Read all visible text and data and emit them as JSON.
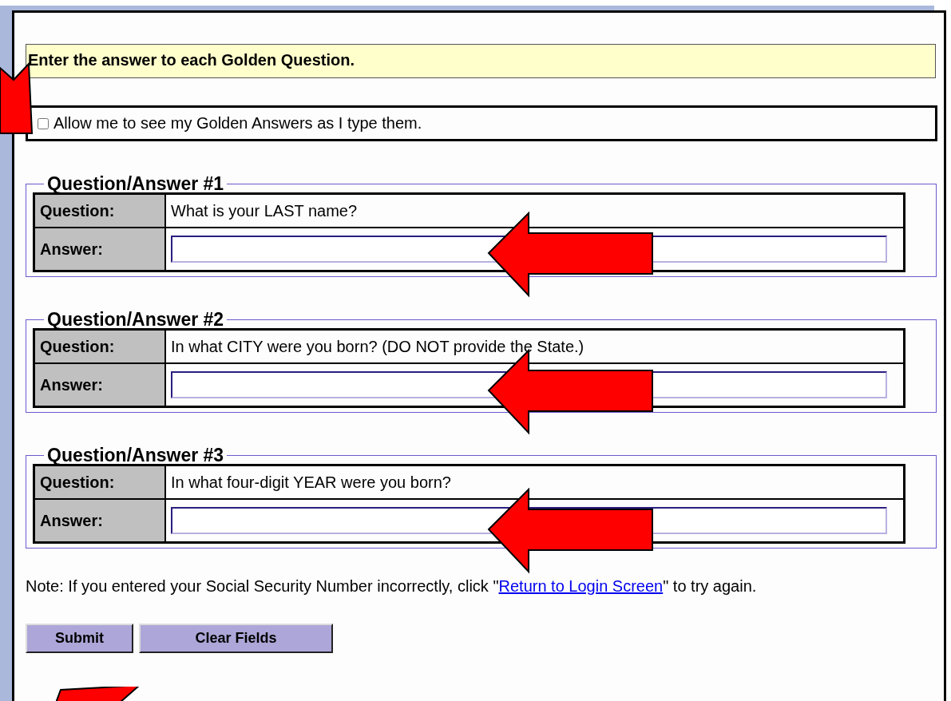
{
  "header": "Enter the answer to each Golden Question.",
  "show_answers": {
    "label": "Allow me to see my Golden Answers as I type them.",
    "checked": false
  },
  "questions": [
    {
      "legend": "Question/Answer #1",
      "question_label": "Question:",
      "question": "What is your LAST name?",
      "answer_label": "Answer:"
    },
    {
      "legend": "Question/Answer #2",
      "question_label": "Question:",
      "question": "In what CITY were you born? (DO NOT provide the State.)",
      "answer_label": "Answer:"
    },
    {
      "legend": "Question/Answer #3",
      "question_label": "Question:",
      "question": "In what four-digit YEAR were you born?",
      "answer_label": "Answer:"
    }
  ],
  "note": {
    "before": "Note: If you entered your Social Security Number incorrectly, click \"",
    "link": "Return to Login Screen",
    "after": "\" to try again."
  },
  "buttons": [
    "Submit",
    "Clear Fields"
  ]
}
